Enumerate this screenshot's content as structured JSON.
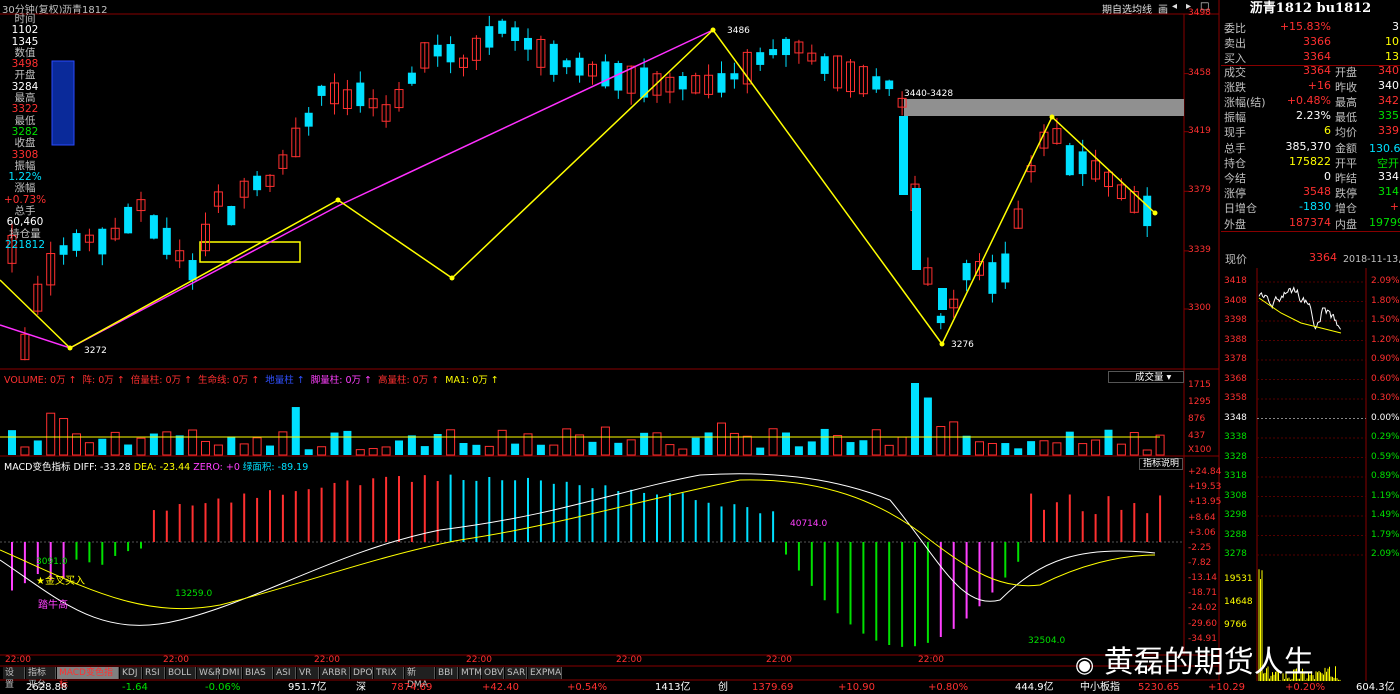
{
  "header": {
    "period": "30分钟(复权)",
    "symbol": "沥青1812",
    "buttons": [
      "期自选",
      "均线",
      "画"
    ],
    "window_icons": [
      "◂",
      "▸",
      "□"
    ]
  },
  "info_panel": [
    {
      "label": "时间",
      "value": "1102",
      "color": "#ffffff"
    },
    {
      "label": "",
      "value": "1345",
      "color": "#ffffff"
    },
    {
      "label": "数值",
      "value": "3498",
      "color": "#ff3030"
    },
    {
      "label": "开盘",
      "value": "3284",
      "color": "#ffffff"
    },
    {
      "label": "最高",
      "value": "3322",
      "color": "#ff3030"
    },
    {
      "label": "最低",
      "value": "3282",
      "color": "#00e000"
    },
    {
      "label": "收盘",
      "value": "3308",
      "color": "#ff3030"
    },
    {
      "label": "振幅",
      "value": "1.22%",
      "color": "#00e0ff"
    },
    {
      "label": "涨幅",
      "value": "+0.73%",
      "color": "#ff3030"
    },
    {
      "label": "总手",
      "value": "60,460",
      "color": "#ffffff"
    },
    {
      "label": "持仓量",
      "value": "221812",
      "color": "#00e0ff"
    }
  ],
  "price_axis": [
    "3498",
    "3458",
    "3419",
    "3379",
    "3339",
    "3300"
  ],
  "annotations": {
    "high": "3486",
    "low_left": "3272",
    "low_right": "3276",
    "gap": "3440-3428"
  },
  "volume_panel": {
    "legend": [
      {
        "text": "VOLUME: 0万",
        "color": "#ff3030"
      },
      {
        "text": "阵: 0万",
        "color": "#ff3030"
      },
      {
        "text": "倍量柱: 0万",
        "color": "#ff3030"
      },
      {
        "text": "生命线: 0万",
        "color": "#ff3030"
      },
      {
        "text": "地量柱",
        "color": "#3050ff"
      },
      {
        "text": "脚量柱: 0万",
        "color": "#ff40ff"
      },
      {
        "text": "高量柱: 0万",
        "color": "#ff3030"
      },
      {
        "text": "MA1: 0万",
        "color": "#ffff00"
      }
    ],
    "dropdown": "成交量",
    "axis": [
      "1715",
      "1295",
      "876",
      "437",
      "X100"
    ]
  },
  "macd_panel": {
    "title": "MACD变色指标",
    "diff": "DIFF: -33.28",
    "dea": "DEA: -23.44",
    "zero": "ZERO: +0",
    "area": "绿面积: -89.19",
    "help_btn": "指标说明",
    "axis": [
      "+24.84",
      "+19.53",
      "+13.95",
      "+8.64",
      "+3.06",
      "-2.25",
      "-7.82",
      "-13.14",
      "-18.71",
      "-24.02",
      "-29.60",
      "-34.91"
    ],
    "labels": [
      "3091.0",
      "13259.0",
      "40714.0",
      "32504.0"
    ],
    "signals": [
      "金叉买入",
      "踏牛高"
    ]
  },
  "time_labels": [
    "22:00",
    "22:00",
    "22:00",
    "22:00",
    "22:00",
    "22:00",
    "22:00"
  ],
  "tabs": [
    "设置",
    "指标平台",
    "MACD变色指标",
    "KDJ",
    "RSI",
    "BOLL",
    "W&R",
    "DMI",
    "BIAS",
    "ASI",
    "VR",
    "ARBR",
    "DPO",
    "TRIX",
    "新DMA",
    "BBI",
    "MTM",
    "OBV",
    "SAR",
    "EXPMA"
  ],
  "quote_panel": {
    "title": "沥青1812 bu1812",
    "rows": [
      {
        "l1": "委比",
        "v1": "+15.83%",
        "c1": "#ff3030",
        "l2": "",
        "v2": "3",
        "c2": "#ffffff"
      },
      {
        "l1": "卖出",
        "v1": "3366",
        "c1": "#ff3030",
        "l2": "",
        "v2": "10",
        "c2": "#ffff00"
      },
      {
        "l1": "买入",
        "v1": "3364",
        "c1": "#ff3030",
        "l2": "",
        "v2": "13",
        "c2": "#ffff00"
      },
      {
        "l1": "成交",
        "v1": "3364",
        "c1": "#ff3030",
        "l2": "开盘",
        "v2": "340",
        "c2": "#ff3030"
      },
      {
        "l1": "涨跌",
        "v1": "+16",
        "c1": "#ff3030",
        "l2": "昨收",
        "v2": "340",
        "c2": "#ffffff"
      },
      {
        "l1": "涨幅(结)",
        "v1": "+0.48%",
        "c1": "#ff3030",
        "l2": "最高",
        "v2": "342",
        "c2": "#ff3030"
      },
      {
        "l1": "振幅",
        "v1": "2.23%",
        "c1": "#ffffff",
        "l2": "最低",
        "v2": "335",
        "c2": "#00e000"
      },
      {
        "l1": "现手",
        "v1": "6",
        "c1": "#ffff00",
        "l2": "均价",
        "v2": "339",
        "c2": "#ff3030"
      },
      {
        "l1": "总手",
        "v1": "385,370",
        "c1": "#ffffff",
        "l2": "金额",
        "v2": "130.6亿",
        "c2": "#00e0ff"
      },
      {
        "l1": "持仓",
        "v1": "175822",
        "c1": "#ffff00",
        "l2": "开平",
        "v2": "空开",
        "c2": "#00e000"
      },
      {
        "l1": "今结",
        "v1": "0",
        "c1": "#ffffff",
        "l2": "昨结",
        "v2": "334",
        "c2": "#ffffff"
      },
      {
        "l1": "涨停",
        "v1": "3548",
        "c1": "#ff3030",
        "l2": "跌停",
        "v2": "314",
        "c2": "#00e000"
      },
      {
        "l1": "日增仓",
        "v1": "-1830",
        "c1": "#00e0ff",
        "l2": "增仓",
        "v2": "+",
        "c2": "#ff3030"
      },
      {
        "l1": "外盘",
        "v1": "187374",
        "c1": "#ff3030",
        "l2": "内盘",
        "v2": "19799",
        "c2": "#00e000"
      }
    ],
    "now_label": "现价",
    "now_value": "3364",
    "date": "2018-11-13,二",
    "mini_prices": [
      "3418",
      "3408",
      "3398",
      "3388",
      "3378",
      "3368",
      "3358",
      "3348",
      "3338",
      "3328",
      "3318",
      "3308",
      "3298",
      "3288",
      "3278"
    ],
    "mini_pcts": [
      "2.09%",
      "1.80%",
      "1.50%",
      "1.20%",
      "0.90%",
      "0.60%",
      "0.30%",
      "0.00%",
      "0.29%",
      "0.59%",
      "0.89%",
      "1.19%",
      "1.49%",
      "1.79%",
      "2.09%"
    ],
    "mini_vol": [
      "19531",
      "14648",
      "9766"
    ]
  },
  "status_bar": [
    {
      "text": "2628.88",
      "color": "#ffffff"
    },
    {
      "text": "-1.64",
      "color": "#00e000"
    },
    {
      "text": "-0.06%",
      "color": "#00e000"
    },
    {
      "text": "951.7亿",
      "color": "#ffffff"
    },
    {
      "text": "深",
      "color": "#ffffff"
    },
    {
      "text": "7874.69",
      "color": "#ff3030"
    },
    {
      "text": "+42.40",
      "color": "#ff3030"
    },
    {
      "text": "+0.54%",
      "color": "#ff3030"
    },
    {
      "text": "1413亿",
      "color": "#ffffff"
    },
    {
      "text": "创",
      "color": "#ffffff"
    },
    {
      "text": "1379.69",
      "color": "#ff3030"
    },
    {
      "text": "+10.90",
      "color": "#ff3030"
    },
    {
      "text": "+0.80%",
      "color": "#ff3030"
    },
    {
      "text": "444.9亿",
      "color": "#ffffff"
    },
    {
      "text": "中小板指",
      "color": "#ffffff"
    },
    {
      "text": "5230.65",
      "color": "#ff3030"
    },
    {
      "text": "+10.29",
      "color": "#ff3030"
    },
    {
      "text": "+0.20%",
      "color": "#ff3030"
    },
    {
      "text": "604.3亿",
      "color": "#ffffff"
    }
  ],
  "watermark": "黄磊的期货人生",
  "colors": {
    "up": "#ff3030",
    "down": "#00e0ff",
    "frame": "#880000",
    "ma": "#ffff00"
  }
}
